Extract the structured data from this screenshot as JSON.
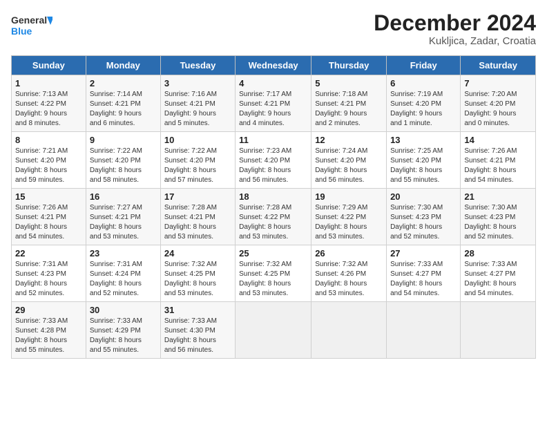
{
  "logo": {
    "line1": "General",
    "line2": "Blue"
  },
  "header": {
    "title": "December 2024",
    "subtitle": "Kukljica, Zadar, Croatia"
  },
  "weekdays": [
    "Sunday",
    "Monday",
    "Tuesday",
    "Wednesday",
    "Thursday",
    "Friday",
    "Saturday"
  ],
  "weeks": [
    [
      {
        "day": "1",
        "info": "Sunrise: 7:13 AM\nSunset: 4:22 PM\nDaylight: 9 hours\nand 8 minutes."
      },
      {
        "day": "2",
        "info": "Sunrise: 7:14 AM\nSunset: 4:21 PM\nDaylight: 9 hours\nand 6 minutes."
      },
      {
        "day": "3",
        "info": "Sunrise: 7:16 AM\nSunset: 4:21 PM\nDaylight: 9 hours\nand 5 minutes."
      },
      {
        "day": "4",
        "info": "Sunrise: 7:17 AM\nSunset: 4:21 PM\nDaylight: 9 hours\nand 4 minutes."
      },
      {
        "day": "5",
        "info": "Sunrise: 7:18 AM\nSunset: 4:21 PM\nDaylight: 9 hours\nand 2 minutes."
      },
      {
        "day": "6",
        "info": "Sunrise: 7:19 AM\nSunset: 4:20 PM\nDaylight: 9 hours\nand 1 minute."
      },
      {
        "day": "7",
        "info": "Sunrise: 7:20 AM\nSunset: 4:20 PM\nDaylight: 9 hours\nand 0 minutes."
      }
    ],
    [
      {
        "day": "8",
        "info": "Sunrise: 7:21 AM\nSunset: 4:20 PM\nDaylight: 8 hours\nand 59 minutes."
      },
      {
        "day": "9",
        "info": "Sunrise: 7:22 AM\nSunset: 4:20 PM\nDaylight: 8 hours\nand 58 minutes."
      },
      {
        "day": "10",
        "info": "Sunrise: 7:22 AM\nSunset: 4:20 PM\nDaylight: 8 hours\nand 57 minutes."
      },
      {
        "day": "11",
        "info": "Sunrise: 7:23 AM\nSunset: 4:20 PM\nDaylight: 8 hours\nand 56 minutes."
      },
      {
        "day": "12",
        "info": "Sunrise: 7:24 AM\nSunset: 4:20 PM\nDaylight: 8 hours\nand 56 minutes."
      },
      {
        "day": "13",
        "info": "Sunrise: 7:25 AM\nSunset: 4:20 PM\nDaylight: 8 hours\nand 55 minutes."
      },
      {
        "day": "14",
        "info": "Sunrise: 7:26 AM\nSunset: 4:21 PM\nDaylight: 8 hours\nand 54 minutes."
      }
    ],
    [
      {
        "day": "15",
        "info": "Sunrise: 7:26 AM\nSunset: 4:21 PM\nDaylight: 8 hours\nand 54 minutes."
      },
      {
        "day": "16",
        "info": "Sunrise: 7:27 AM\nSunset: 4:21 PM\nDaylight: 8 hours\nand 53 minutes."
      },
      {
        "day": "17",
        "info": "Sunrise: 7:28 AM\nSunset: 4:21 PM\nDaylight: 8 hours\nand 53 minutes."
      },
      {
        "day": "18",
        "info": "Sunrise: 7:28 AM\nSunset: 4:22 PM\nDaylight: 8 hours\nand 53 minutes."
      },
      {
        "day": "19",
        "info": "Sunrise: 7:29 AM\nSunset: 4:22 PM\nDaylight: 8 hours\nand 53 minutes."
      },
      {
        "day": "20",
        "info": "Sunrise: 7:30 AM\nSunset: 4:23 PM\nDaylight: 8 hours\nand 52 minutes."
      },
      {
        "day": "21",
        "info": "Sunrise: 7:30 AM\nSunset: 4:23 PM\nDaylight: 8 hours\nand 52 minutes."
      }
    ],
    [
      {
        "day": "22",
        "info": "Sunrise: 7:31 AM\nSunset: 4:23 PM\nDaylight: 8 hours\nand 52 minutes."
      },
      {
        "day": "23",
        "info": "Sunrise: 7:31 AM\nSunset: 4:24 PM\nDaylight: 8 hours\nand 52 minutes."
      },
      {
        "day": "24",
        "info": "Sunrise: 7:32 AM\nSunset: 4:25 PM\nDaylight: 8 hours\nand 53 minutes."
      },
      {
        "day": "25",
        "info": "Sunrise: 7:32 AM\nSunset: 4:25 PM\nDaylight: 8 hours\nand 53 minutes."
      },
      {
        "day": "26",
        "info": "Sunrise: 7:32 AM\nSunset: 4:26 PM\nDaylight: 8 hours\nand 53 minutes."
      },
      {
        "day": "27",
        "info": "Sunrise: 7:33 AM\nSunset: 4:27 PM\nDaylight: 8 hours\nand 54 minutes."
      },
      {
        "day": "28",
        "info": "Sunrise: 7:33 AM\nSunset: 4:27 PM\nDaylight: 8 hours\nand 54 minutes."
      }
    ],
    [
      {
        "day": "29",
        "info": "Sunrise: 7:33 AM\nSunset: 4:28 PM\nDaylight: 8 hours\nand 55 minutes."
      },
      {
        "day": "30",
        "info": "Sunrise: 7:33 AM\nSunset: 4:29 PM\nDaylight: 8 hours\nand 55 minutes."
      },
      {
        "day": "31",
        "info": "Sunrise: 7:33 AM\nSunset: 4:30 PM\nDaylight: 8 hours\nand 56 minutes."
      },
      {
        "day": "",
        "info": ""
      },
      {
        "day": "",
        "info": ""
      },
      {
        "day": "",
        "info": ""
      },
      {
        "day": "",
        "info": ""
      }
    ]
  ]
}
